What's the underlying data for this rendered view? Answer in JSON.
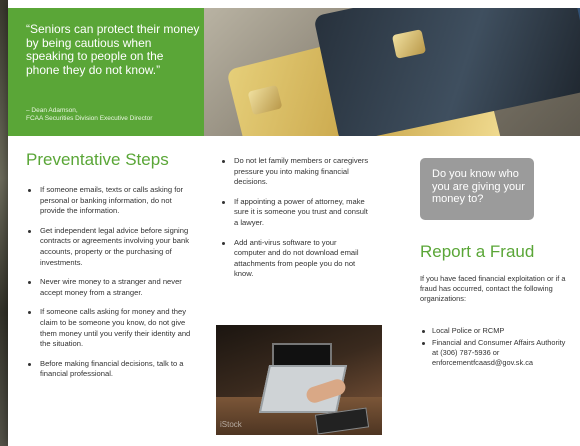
{
  "quote": {
    "text": "“Seniors can protect their money by being cautious when speaking to people on the phone they do not know.”",
    "attribution": "– Dean Adamson,",
    "attribution_title": "FCAA Securities Division Executive Director"
  },
  "preventative": {
    "title": "Preventative Steps",
    "col1": [
      "If someone emails, texts or calls asking for personal or banking information, do not provide the information.",
      "Get independent legal advice before signing contracts or agreements involving your bank accounts, property or the purchasing of investments.",
      "Never wire money to a stranger and never accept money from a stranger.",
      "If someone calls asking for money and they claim to be someone you know, do not give them money until you verify their identity and the situation.",
      "Before making financial decisions, talk to a financial professional."
    ],
    "col2": [
      "Do not let family members or caregivers pressure you into making financial decisions.",
      "If appointing a power of attorney, make sure it is someone you trust and consult a lawyer.",
      "Add anti-virus software to your computer and do not download email attachments from people you do not know."
    ]
  },
  "photo_watermark": "iStock",
  "callout": "Do you know who you are giving your money to?",
  "report": {
    "title": "Report a Fraud",
    "text": "If you have faced financial exploitation or if a fraud has occurred, contact the following organizations:",
    "items": [
      "Local Police or RCMP",
      "Financial and Consumer Affairs Authority at (306) 787-5936 or enforcementfcaasd@gov.sk.ca"
    ]
  }
}
